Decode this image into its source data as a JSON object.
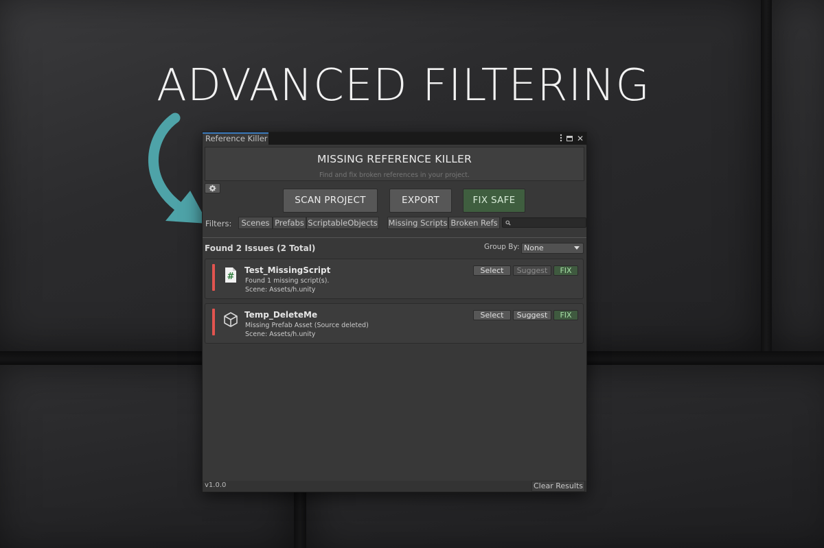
{
  "headline": "ADVANCED FILTERING",
  "window": {
    "tab_title": "Reference Killer",
    "controls": {
      "menu_icon": "kebab-menu-icon",
      "maximize_icon": "maximize-icon",
      "close_glyph": "✕"
    }
  },
  "header": {
    "title": "MISSING REFERENCE KILLER",
    "subtitle": "Find and fix broken references in your project."
  },
  "toolbar": {
    "settings_icon": "gear-icon",
    "scan_label": "SCAN PROJECT",
    "export_label": "EXPORT",
    "fix_safe_label": "FIX SAFE"
  },
  "filters": {
    "label": "Filters:",
    "asset_types": [
      "Scenes",
      "Prefabs",
      "ScriptableObjects"
    ],
    "issue_types": [
      "Missing Scripts",
      "Broken Refs"
    ],
    "search_placeholder": ""
  },
  "results": {
    "summary": "Found 2 Issues (2 Total)",
    "group_by_label": "Group By:",
    "group_by_value": "None",
    "issues": [
      {
        "title": "Test_MissingScript",
        "description": "Found 1 missing script(s).",
        "scene": "Scene: Assets/h.unity",
        "icon": "script-hash-icon",
        "severity_color": "#e2544f",
        "select_label": "Select",
        "suggest_label": "Suggest",
        "suggest_enabled": false,
        "fix_label": "FIX"
      },
      {
        "title": "Temp_DeleteMe",
        "description": "Missing Prefab Asset (Source deleted)",
        "scene": "Scene: Assets/h.unity",
        "icon": "prefab-cube-icon",
        "severity_color": "#e2544f",
        "select_label": "Select",
        "suggest_label": "Suggest",
        "suggest_enabled": true,
        "fix_label": "FIX"
      }
    ]
  },
  "status": {
    "version": "v1.0.0",
    "clear_label": "Clear Results"
  },
  "colors": {
    "accent_arrow": "#4ea3a8",
    "fix_green": "#3f5e3f",
    "severity_red": "#e2544f",
    "tab_accent": "#3a79bb"
  }
}
